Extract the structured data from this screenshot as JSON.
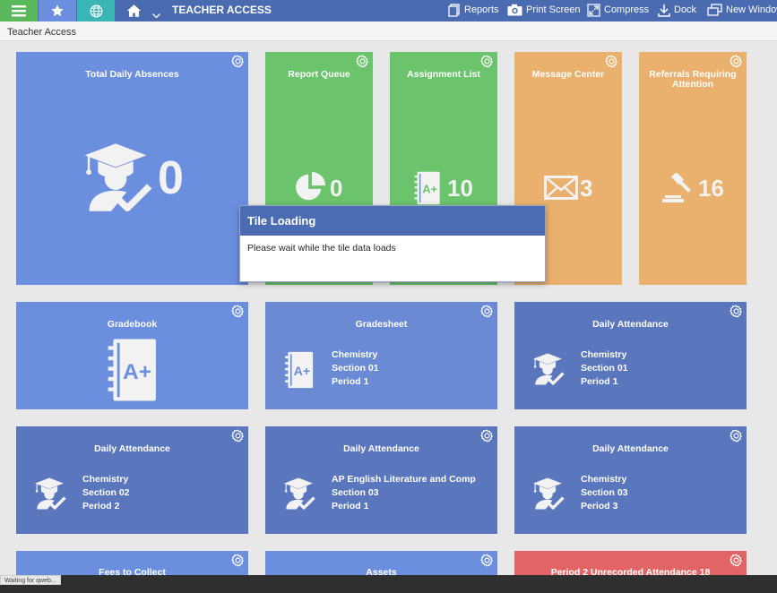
{
  "topbar": {
    "title": "TEACHER ACCESS",
    "actions": {
      "reports": "Reports",
      "print_screen": "Print Screen",
      "compress": "Compress",
      "dock": "Dock",
      "new_window": "New Window"
    },
    "colors": {
      "menu": "#5cb85c",
      "favorites": "#6b8ede",
      "globe": "#39b5b5",
      "home": "#4a6bb0"
    }
  },
  "breadcrumb": "Teacher Access",
  "tiles": {
    "absences": {
      "title": "Total Daily Absences",
      "value": "0",
      "icon": "graduate-check-icon"
    },
    "report_queue": {
      "title": "Report Queue",
      "value": "0",
      "icon": "pie-chart-icon"
    },
    "assignment_list": {
      "title": "Assignment List",
      "value": "10",
      "icon": "gradebook-icon"
    },
    "message_center": {
      "title": "Message Center",
      "value": "3",
      "icon": "envelope-icon"
    },
    "referrals": {
      "title": "Referrals Requiring Attention",
      "value": "16",
      "icon": "gavel-icon"
    },
    "gradebook": {
      "title": "Gradebook",
      "icon": "gradebook-icon"
    },
    "gradesheet": {
      "title": "Gradesheet",
      "course": "Chemistry",
      "section": "Section 01",
      "period": "Period 1"
    },
    "attendance_1": {
      "title": "Daily Attendance",
      "course": "Chemistry",
      "section": "Section 01",
      "period": "Period 1"
    },
    "attendance_2": {
      "title": "Daily Attendance",
      "course": "Chemistry",
      "section": "Section 02",
      "period": "Period 2"
    },
    "attendance_3": {
      "title": "Daily Attendance",
      "course": "AP English Literature and Comp",
      "section": "Section 03",
      "period": "Period 1"
    },
    "attendance_4": {
      "title": "Daily Attendance",
      "course": "Chemistry",
      "section": "Section 03",
      "period": "Period 3"
    },
    "fees": {
      "title": "Fees to Collect"
    },
    "assets": {
      "title": "Assets"
    },
    "unrecorded": {
      "title": "Period 2 Unrecorded Attendance 18"
    }
  },
  "modal": {
    "title": "Tile Loading",
    "message": "Please wait while the tile data loads"
  },
  "status": "Waiting for qweb..."
}
